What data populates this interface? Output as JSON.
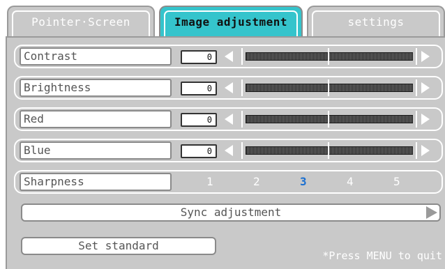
{
  "tabs": [
    {
      "label": "Pointer·Screen",
      "active": false
    },
    {
      "label": "Image adjustment",
      "active": true
    },
    {
      "label": "settings",
      "active": false
    }
  ],
  "sliders": [
    {
      "label": "Contrast",
      "value": "0"
    },
    {
      "label": "Brightness",
      "value": "0"
    },
    {
      "label": "Red",
      "value": "0"
    },
    {
      "label": "Blue",
      "value": "0"
    }
  ],
  "sharpness": {
    "label": "Sharpness",
    "levels": [
      "1",
      "2",
      "3",
      "4",
      "5"
    ],
    "selected": "3"
  },
  "sync_label": "Sync adjustment",
  "standard_label": "Set standard",
  "quit_hint": "*Press MENU to quit",
  "colors": {
    "active_tab": "#35c4cc",
    "panel": "#c9c9c9",
    "selected_level": "#1a6fd1"
  }
}
